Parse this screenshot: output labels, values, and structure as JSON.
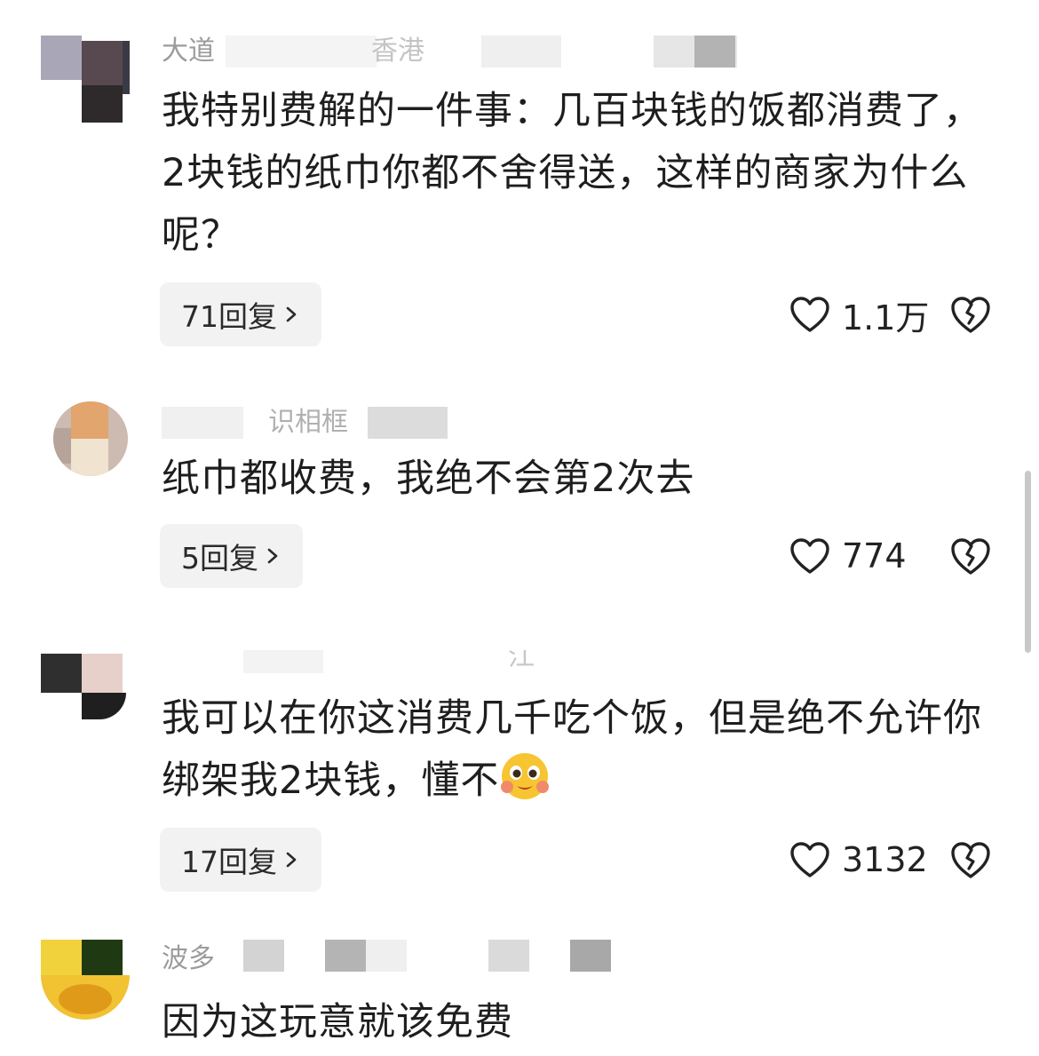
{
  "comments": [
    {
      "meta_visible": "大道",
      "meta_visible_2": "香港",
      "body": "我特别费解的一件事：几百块钱的饭都消费了，2块钱的纸巾你都不舍得送，这样的商家为什么呢？",
      "reply_label": "71回复",
      "likes": "1.1万"
    },
    {
      "meta_visible": "识相框",
      "body": "纸巾都收费，我绝不会第2次去",
      "reply_label": "5回复",
      "likes": "774"
    },
    {
      "meta_visible": "江苏",
      "body": "我可以在你这消费几千吃个饭，但是绝不允许你绑架我2块钱，懂不",
      "emoji": "pleading-face-emoji",
      "reply_label": "17回复",
      "likes": "3132"
    },
    {
      "meta_visible": "波多",
      "body": "因为这玩意就该免费"
    }
  ],
  "icons": {
    "like": "heart-outline-icon",
    "dislike": "broken-heart-icon",
    "chevron": "chevron-right-icon"
  },
  "colors": {
    "text": "#1e1e1e",
    "meta": "#9b9b9b",
    "reply_bg": "#f2f2f2"
  }
}
